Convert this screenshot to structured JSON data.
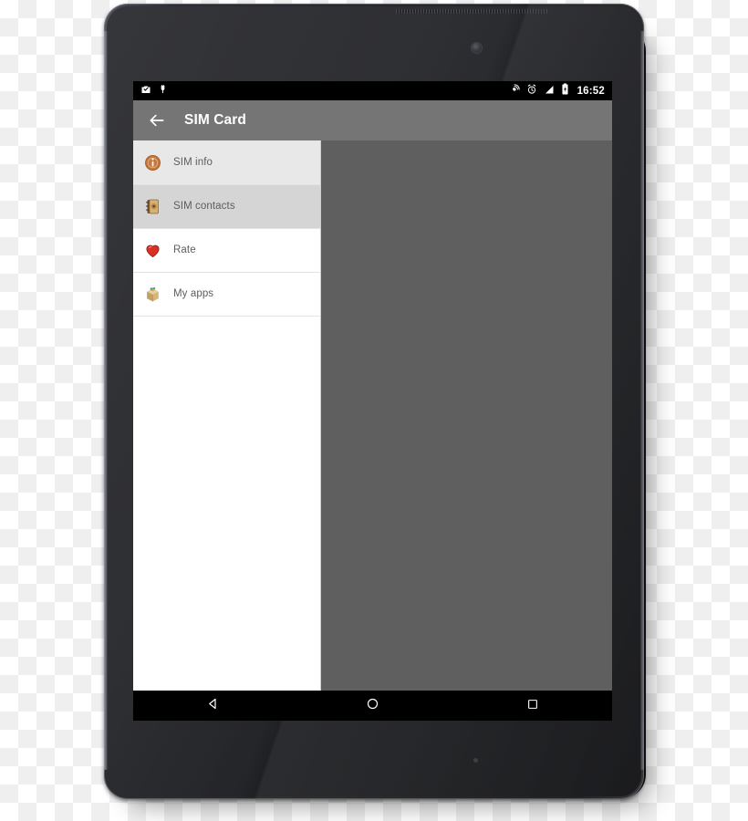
{
  "device": {
    "type": "android-tablet",
    "components": {
      "speaker_grille": "speaker-grille",
      "front_camera": "front-camera-icon",
      "bottom_mic": "microphone-hole"
    }
  },
  "status_bar": {
    "background": "#000000",
    "left_icons": [
      {
        "name": "screenshot-icon",
        "label": "Screenshot"
      },
      {
        "name": "usb-debug-icon",
        "label": "USB debugging"
      }
    ],
    "right_icons": [
      {
        "name": "cast-icon",
        "label": "Cast"
      },
      {
        "name": "alarm-clock-icon",
        "label": "Alarm set"
      },
      {
        "name": "signal-strength-icon",
        "label": "Mobile signal"
      },
      {
        "name": "battery-icon",
        "label": "Battery"
      }
    ],
    "clock": "16:52"
  },
  "app_bar": {
    "background": "#757575",
    "back_icon": "back-arrow-icon",
    "title": "SIM Card"
  },
  "nav_drawer": {
    "background": "#ffffff",
    "items": [
      {
        "label": "SIM info",
        "icon": "info-badge-icon",
        "icon_color": "#c4793f",
        "state": "hover",
        "background": "#e8e8e8"
      },
      {
        "label": "SIM contacts",
        "icon": "address-book-icon",
        "icon_color": "#7a5c33",
        "state": "selected",
        "background": "#d5d5d5"
      },
      {
        "label": "Rate",
        "icon": "heart-icon",
        "icon_color": "#d93025",
        "state": "normal",
        "background": "#ffffff"
      },
      {
        "label": "My apps",
        "icon": "package-box-icon",
        "icon_color": "#c9a86a",
        "state": "normal",
        "background": "#ffffff"
      }
    ]
  },
  "content_pane": {
    "background": "#5f5f5f",
    "content": ""
  },
  "nav_bar": {
    "background": "#000000",
    "buttons": [
      {
        "name": "back-button",
        "icon": "triangle-left-icon",
        "label": "Back"
      },
      {
        "name": "home-button",
        "icon": "circle-icon",
        "label": "Home"
      },
      {
        "name": "recents-button",
        "icon": "square-icon",
        "label": "Recents"
      }
    ]
  }
}
